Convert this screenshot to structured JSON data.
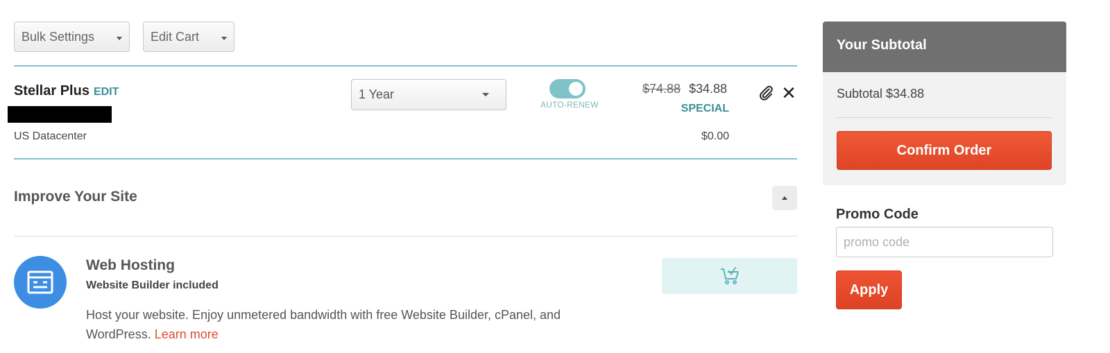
{
  "toolbar": {
    "bulk_settings": "Bulk Settings",
    "edit_cart": "Edit Cart"
  },
  "cart_item": {
    "name": "Stellar Plus",
    "edit_label": "EDIT",
    "datacenter": "US Datacenter",
    "term": "1 Year",
    "auto_renew_label": "AUTO-RENEW",
    "auto_renew_on": true,
    "price_old": "$74.88",
    "price_new": "$34.88",
    "price_tag": "SPECIAL",
    "addon_price": "$0.00",
    "icons": [
      "paperclip-icon",
      "close-icon"
    ]
  },
  "improve": {
    "title": "Improve Your Site",
    "product": {
      "title": "Web Hosting",
      "subtitle": "Website Builder included",
      "description": "Host your website. Enjoy unmetered bandwidth with free Website Builder, cPanel, and WordPress.",
      "learn_more": "Learn more",
      "icon": "server-icon",
      "cart_icon": "cart-check-icon"
    }
  },
  "summary": {
    "title": "Your Subtotal",
    "subtotal_text": "Subtotal $34.88",
    "confirm_label": "Confirm Order",
    "promo_title": "Promo Code",
    "promo_placeholder": "promo code",
    "apply_label": "Apply"
  },
  "colors": {
    "teal": "#7fc3c9",
    "teal_text": "#3c8f96",
    "accent_orange": "#e24a2c",
    "icon_blue": "#3d8ee3",
    "panel_header": "#707070"
  }
}
